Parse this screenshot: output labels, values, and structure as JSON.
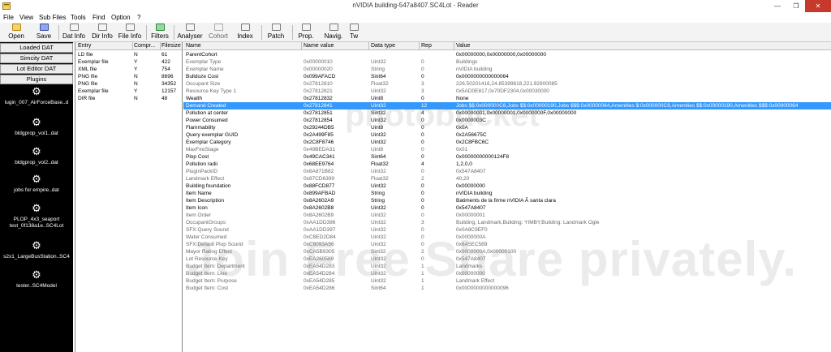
{
  "window": {
    "title": "nVIDIA building-547a8407.SC4Lot - Reader",
    "icon": "app-icon",
    "min_glyph": "—",
    "max_glyph": "❐",
    "close_glyph": "✕"
  },
  "menu": [
    "File",
    "View",
    "Sub Files",
    "Tools",
    "Find",
    "Option",
    "?"
  ],
  "toolbar": [
    {
      "label": "Open",
      "icon": "open-icon"
    },
    {
      "label": "Save",
      "icon": "save-icon"
    },
    {
      "label": "Dat Info",
      "icon": "dat-info-icon"
    },
    {
      "label": "Dir Info",
      "icon": "dir-info-icon"
    },
    {
      "label": "File Info",
      "icon": "file-info-icon"
    },
    {
      "label": "Filters",
      "icon": "filters-icon"
    },
    {
      "label": "Analyser",
      "icon": "analyser-icon"
    },
    {
      "label": "Cohort",
      "icon": "cohort-icon"
    },
    {
      "label": "Index",
      "icon": "index-icon"
    },
    {
      "label": "Patch",
      "icon": "patch-icon"
    },
    {
      "label": "Prop.",
      "icon": "prop-icon"
    },
    {
      "label": "Navig.",
      "icon": "navig-icon"
    },
    {
      "label": "Tw",
      "icon": "tw-icon"
    }
  ],
  "leftnav": {
    "buttons": [
      "Loaded DAT",
      "Simcity DAT",
      "Lot Editor DAT",
      "Plugins"
    ],
    "plugins": [
      "lugin_007_AirForceBase..d",
      "bldgprop_vol1..dat",
      "bldgprop_vol2..dat",
      "jobs for empire..dat",
      "PLOP_4x3_seaport test_0f138a1e..SC4Lot",
      "s2x1_LargeBusStation..SC4",
      "tester..SC4Model"
    ]
  },
  "entries": {
    "columns": [
      "Entry",
      "Compr...",
      "Filesize"
    ],
    "rows": [
      [
        "LD file",
        "N",
        "61"
      ],
      [
        "Exemplar file",
        "Y",
        "422"
      ],
      [
        "XML file",
        "Y",
        "754"
      ],
      [
        "PNG file",
        "N",
        "8696"
      ],
      [
        "PNG file",
        "N",
        "34352"
      ],
      [
        "Exemplar file",
        "Y",
        "12157"
      ],
      [
        "DIR file",
        "N",
        "48"
      ]
    ]
  },
  "grid": {
    "columns": [
      "Name",
      "Name value",
      "Data type",
      "Rep",
      "Value"
    ],
    "rows": [
      [
        "ParentCohort",
        "",
        "",
        "",
        "0x00000000,0x00000000,0x00000000"
      ],
      [
        "Exemplar Type",
        "0x00000010",
        "Uint32",
        "0",
        "Buildings"
      ],
      [
        "Exemplar Name",
        "0x00000020",
        "String",
        "0",
        "nVIDIA building"
      ],
      [
        "Bulldoze Cost",
        "0x099AFACD",
        "Sint64",
        "0",
        "0x0000000000000064"
      ],
      [
        "Occupant Size",
        "0x27812810",
        "Float32",
        "3",
        "226.50201416,24.85399818,221.92900085"
      ],
      [
        "Resource Key Type 1",
        "0x27812821",
        "Uint32",
        "3",
        "0x5AD0E817,0x70DF2304,0x00030000"
      ],
      [
        "Wealth",
        "0x27812832",
        "Uint8",
        "0",
        "None"
      ],
      [
        "Demand Created",
        "0x27812841",
        "Uint32",
        "12",
        "Jobs $$:0x000000C8,Jobs $$:0x00000190,Jobs $$$:0x00000064,Amenities $:0x000000C8,Amenities $$:0x00000190,Amenities $$$:0x00000064"
      ],
      [
        "Pollution at center",
        "0x27812851",
        "Sint32",
        "4",
        "0x00000001,0x00000001,0x0000000F,0x00000000"
      ],
      [
        "Power Consumed",
        "0x27812854",
        "Uint32",
        "0",
        "0x0000003C"
      ],
      [
        "Flammability",
        "0x29244DB5",
        "Uint8",
        "0",
        "0x0A"
      ],
      [
        "Query exemplar GUID",
        "0x2A499F85",
        "Uint32",
        "0",
        "0x2A56675C"
      ],
      [
        "Exemplar Category",
        "0x2C8F8746",
        "Uint32",
        "0",
        "0x2C8FBC6C"
      ],
      [
        "MaxFireStage",
        "0x49BEDA31",
        "Uint8",
        "0",
        "0x01"
      ],
      [
        "Plop Cost",
        "0x49CAC341",
        "Sint64",
        "0",
        "0x00000000000124F8"
      ],
      [
        "Pollution radii",
        "0x68EE9764",
        "Float32",
        "4",
        "1,2,0,0"
      ],
      [
        "PluginPackID",
        "0x6A871B82",
        "Uint32",
        "0",
        "0x547A8407"
      ],
      [
        "Landmark Effect",
        "0x87CD6399",
        "Float32",
        "2",
        "40,20"
      ],
      [
        "Building foundation",
        "0x88FCD877",
        "Uint32",
        "0",
        "0x00000000"
      ],
      [
        "Item Name",
        "0x899AFBAD",
        "String",
        "0",
        "nVIDIA building"
      ],
      [
        "Item Description",
        "0x8A2602A9",
        "String",
        "0",
        "Batiments de la firme nVIDIA Ã  santa clara"
      ],
      [
        "Item Icon",
        "0x8A2602B8",
        "Uint32",
        "0",
        "0x547A8407"
      ],
      [
        "Item Order",
        "0x8A2602B9",
        "Uint32",
        "0",
        "0x00000001"
      ],
      [
        "OccupantGroups",
        "0xAA1DD396",
        "Uint32",
        "3",
        "Building, Landmark,Building: YIMBY,Building: Landmark Ogle"
      ],
      [
        "SFX:Query Sound",
        "0xAA1DD397",
        "Uint32",
        "0",
        "0x0A8C9EF0"
      ],
      [
        "Water Consumed",
        "0xC8ED2D84",
        "Uint32",
        "0",
        "0x0000000A"
      ],
      [
        "SFX:Default Plop Sound",
        "0xC9093A56",
        "Uint32",
        "0",
        "0x6A5EC589"
      ],
      [
        "Mayor Rating Effect",
        "0xCA5B9305",
        "Sint32",
        "2",
        "0x0000000A,0x00000100"
      ],
      [
        "Lot Resource Key",
        "0xEA260589",
        "Uint32",
        "0",
        "0x547A8407"
      ],
      [
        "Budget Item: Department",
        "0xEA54D283",
        "Uint32",
        "1",
        "Landmarks"
      ],
      [
        "Budget Item: Line",
        "0xEA54D284",
        "Uint32",
        "1",
        "0x00000000"
      ],
      [
        "Budget Item: Purpose",
        "0xEA54D285",
        "Uint32",
        "1",
        "Landmark Effect"
      ],
      [
        "Budget Item: Cost",
        "0xEA54D286",
        "Sint64",
        "1",
        "0x0000000000000096"
      ]
    ],
    "selected_index": 7,
    "muted_indices": [
      1,
      2,
      4,
      5,
      13,
      16,
      17,
      22,
      23,
      24,
      25,
      26,
      27,
      28,
      29,
      30,
      31,
      32
    ]
  },
  "watermark": {
    "small": "photobucket",
    "big": "Join Free Share privately."
  }
}
